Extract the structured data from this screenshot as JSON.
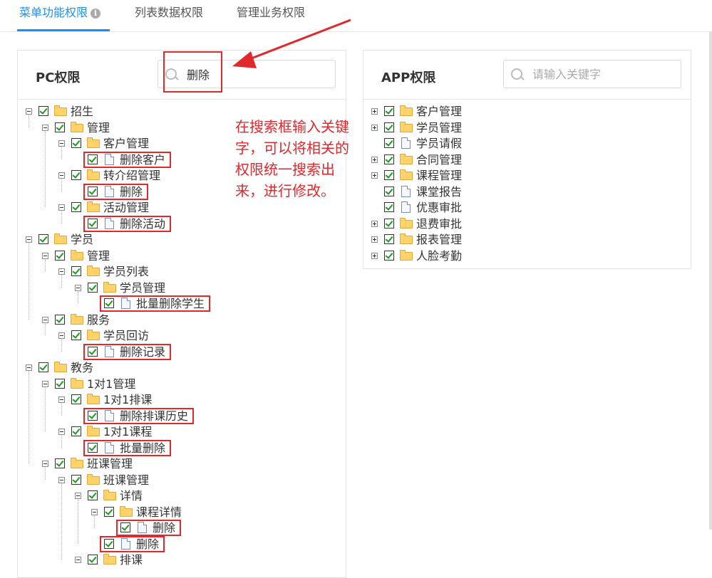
{
  "tabs": [
    "菜单功能权限",
    "列表数据权限",
    "管理业务权限"
  ],
  "pc": {
    "title": "PC权限",
    "search_value": "删除",
    "tree": [
      {
        "label": "招生",
        "d": 0,
        "t": "folder",
        "tog": "minus"
      },
      {
        "label": "管理",
        "d": 1,
        "t": "folder",
        "tog": "minus"
      },
      {
        "label": "客户管理",
        "d": 2,
        "t": "folder",
        "tog": "minus"
      },
      {
        "label": "删除客户",
        "d": 3,
        "t": "file",
        "hl": true
      },
      {
        "label": "转介绍管理",
        "d": 2,
        "t": "folder",
        "tog": "minus"
      },
      {
        "label": "删除",
        "d": 3,
        "t": "file",
        "hl": true
      },
      {
        "label": "活动管理",
        "d": 2,
        "t": "folder",
        "tog": "minus"
      },
      {
        "label": "删除活动",
        "d": 3,
        "t": "file",
        "hl": true
      },
      {
        "label": "学员",
        "d": 0,
        "t": "folder",
        "tog": "minus"
      },
      {
        "label": "管理",
        "d": 1,
        "t": "folder",
        "tog": "minus"
      },
      {
        "label": "学员列表",
        "d": 2,
        "t": "folder",
        "tog": "minus"
      },
      {
        "label": "学员管理",
        "d": 3,
        "t": "folder",
        "tog": "minus"
      },
      {
        "label": "批量删除学生",
        "d": 4,
        "t": "file",
        "hl": true
      },
      {
        "label": "服务",
        "d": 1,
        "t": "folder",
        "tog": "minus"
      },
      {
        "label": "学员回访",
        "d": 2,
        "t": "folder",
        "tog": "minus"
      },
      {
        "label": "删除记录",
        "d": 3,
        "t": "file",
        "hl": true
      },
      {
        "label": "教务",
        "d": 0,
        "t": "folder",
        "tog": "minus"
      },
      {
        "label": "1对1管理",
        "d": 1,
        "t": "folder",
        "tog": "minus"
      },
      {
        "label": "1对1排课",
        "d": 2,
        "t": "folder",
        "tog": "minus"
      },
      {
        "label": "删除排课历史",
        "d": 3,
        "t": "file",
        "hl": true
      },
      {
        "label": "1对1课程",
        "d": 2,
        "t": "folder",
        "tog": "minus"
      },
      {
        "label": "批量删除",
        "d": 3,
        "t": "file",
        "hl": true
      },
      {
        "label": "班课管理",
        "d": 1,
        "t": "folder",
        "tog": "minus"
      },
      {
        "label": "班课管理",
        "d": 2,
        "t": "folder",
        "tog": "minus"
      },
      {
        "label": "详情",
        "d": 3,
        "t": "folder",
        "tog": "minus"
      },
      {
        "label": "课程详情",
        "d": 4,
        "t": "folder",
        "tog": "minus"
      },
      {
        "label": "删除",
        "d": 5,
        "t": "file",
        "hl": true
      },
      {
        "label": "删除",
        "d": 4,
        "t": "file",
        "hl": true
      },
      {
        "label": "排课",
        "d": 3,
        "t": "folder",
        "tog": "minus"
      }
    ]
  },
  "app": {
    "title": "APP权限",
    "search_placeholder": "请输入关键字",
    "tree": [
      {
        "label": "客户管理",
        "t": "folder",
        "tog": "plus"
      },
      {
        "label": "学员管理",
        "t": "folder",
        "tog": "plus"
      },
      {
        "label": "学员请假",
        "t": "file"
      },
      {
        "label": "合同管理",
        "t": "folder",
        "tog": "plus"
      },
      {
        "label": "课程管理",
        "t": "folder",
        "tog": "plus"
      },
      {
        "label": "课堂报告",
        "t": "file"
      },
      {
        "label": "优惠审批",
        "t": "file"
      },
      {
        "label": "退费审批",
        "t": "folder",
        "tog": "plus"
      },
      {
        "label": "报表管理",
        "t": "folder",
        "tog": "plus"
      },
      {
        "label": "人脸考勤",
        "t": "folder",
        "tog": "plus"
      }
    ]
  },
  "annotation": "在搜索框输入关键字，可以将相关的权限统一搜索出来，进行修改。",
  "colors": {
    "accent": "#1890ff",
    "highlight": "#e0282d",
    "check": "#1a9b1a"
  }
}
